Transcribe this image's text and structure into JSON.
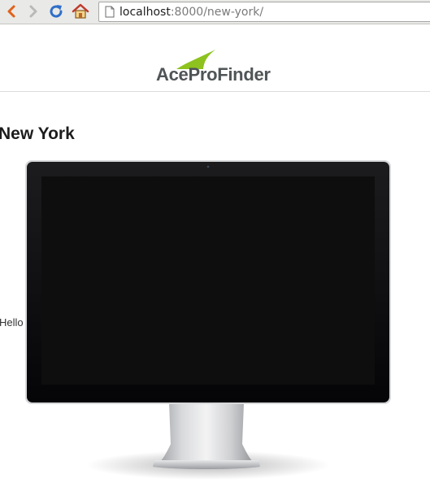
{
  "browser": {
    "url_host": "localhost",
    "url_rest": ":8000/new-york/",
    "icons": [
      "back-icon",
      "forward-icon",
      "reload-icon",
      "home-icon",
      "page-icon"
    ]
  },
  "site": {
    "logo_text": "AceProFinder",
    "brand_colors": {
      "swoosh": "#8dc21f",
      "wordmark": "#4f5457"
    }
  },
  "content": {
    "heading": "New York",
    "body_text": "Hello",
    "image": "monitor-icon"
  }
}
